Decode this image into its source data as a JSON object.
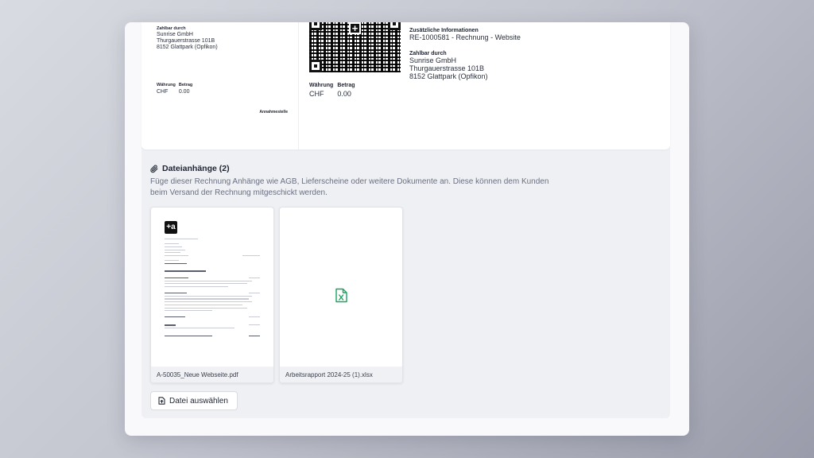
{
  "receipt": {
    "payable_label": "Zahlbar durch",
    "payer_name": "Sunrise GmbH",
    "payer_street": "Thurgauerstrasse 101B",
    "payer_city": "8152 Glattpark (Opfikon)",
    "currency_label": "Währung",
    "amount_label": "Betrag",
    "currency": "CHF",
    "amount": "0.00",
    "acceptance_point": "Annahmestelle"
  },
  "payment": {
    "info_label": "Zusätzliche Informationen",
    "info_value": "RE-1000581 - Rechnung - Website",
    "payable_label": "Zahlbar durch",
    "payer_name": "Sunrise GmbH",
    "payer_street": "Thurgauerstrasse 101B",
    "payer_city": "8152 Glattpark (Opfikon)",
    "currency_label": "Währung",
    "amount_label": "Betrag",
    "currency": "CHF",
    "amount": "0.00"
  },
  "attachments": {
    "title": "Dateianhänge (2)",
    "description": "Füge dieser Rechnung Anhänge wie AGB, Lieferscheine oder weitere Dokumente an. Diese können dem Kunden beim Versand der Rechnung mitgeschickt werden.",
    "files": [
      {
        "name": "A-50035_Neue Webseite.pdf",
        "type": "pdf",
        "logo_text": "+a"
      },
      {
        "name": "Arbeitsrapport 2024-25 (1).xlsx",
        "type": "xlsx"
      }
    ],
    "select_button": "Datei auswählen"
  },
  "colors": {
    "xlsx_icon": "#1aa35f",
    "panel_bg": "#eff0f4"
  },
  "icons": {
    "attachment": "paperclip-icon",
    "xlsx": "xlsx-file-icon",
    "upload": "file-upload-icon"
  }
}
